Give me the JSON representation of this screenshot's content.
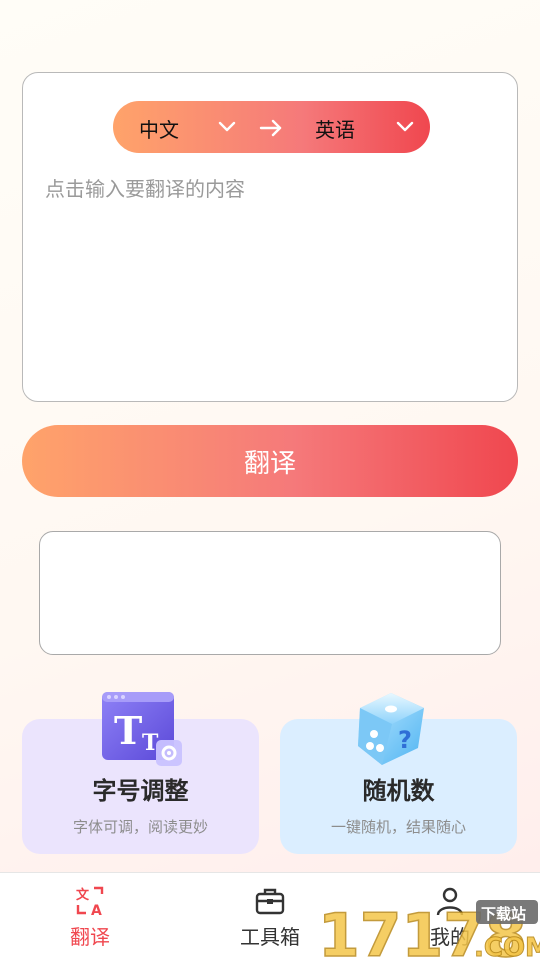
{
  "translator": {
    "source_lang": "中文",
    "target_lang": "英语",
    "placeholder": "点击输入要翻译的内容",
    "translate_button": "翻译",
    "result_text": ""
  },
  "tools": [
    {
      "title": "字号调整",
      "subtitle": "字体可调，阅读更妙",
      "icon": "font-size-icon"
    },
    {
      "title": "随机数",
      "subtitle": "一键随机，结果随心",
      "icon": "dice-icon"
    }
  ],
  "tabbar": {
    "items": [
      {
        "label": "翻译",
        "icon": "translate-icon",
        "active": true
      },
      {
        "label": "工具箱",
        "icon": "toolbox-icon",
        "active": false
      },
      {
        "label": "我的",
        "icon": "profile-icon",
        "active": false
      }
    ]
  },
  "watermark": {
    "number": "17178",
    "tag": "下载站",
    "suffix": ".COM"
  },
  "colors": {
    "accent_start": "#ffa36a",
    "accent_end": "#f0474f",
    "font_card_bg": "#ebe4fd",
    "rand_card_bg": "#dbeeff",
    "active_tab": "#f0474f"
  }
}
